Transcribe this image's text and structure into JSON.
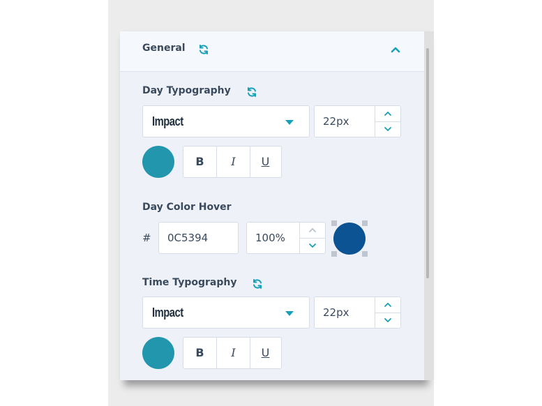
{
  "section": {
    "title": "General"
  },
  "day_typography": {
    "label": "Day Typography",
    "font": "Impact",
    "size": "22px",
    "color": "#2196ad",
    "bold": "B",
    "italic": "I",
    "underline": "U"
  },
  "day_color_hover": {
    "label": "Day Color Hover",
    "hash": "#",
    "hex": "0C5394",
    "opacity": "100%",
    "color": "#0c5394"
  },
  "time_typography": {
    "label": "Time Typography",
    "font": "Impact",
    "size": "22px",
    "color": "#2196ad",
    "bold": "B",
    "italic": "I",
    "underline": "U"
  },
  "colors": {
    "accent": "#17a1b8",
    "panel_bg": "#eef2f8"
  },
  "icons": {
    "sync": "sync-icon",
    "collapse": "chevron-up-icon"
  }
}
